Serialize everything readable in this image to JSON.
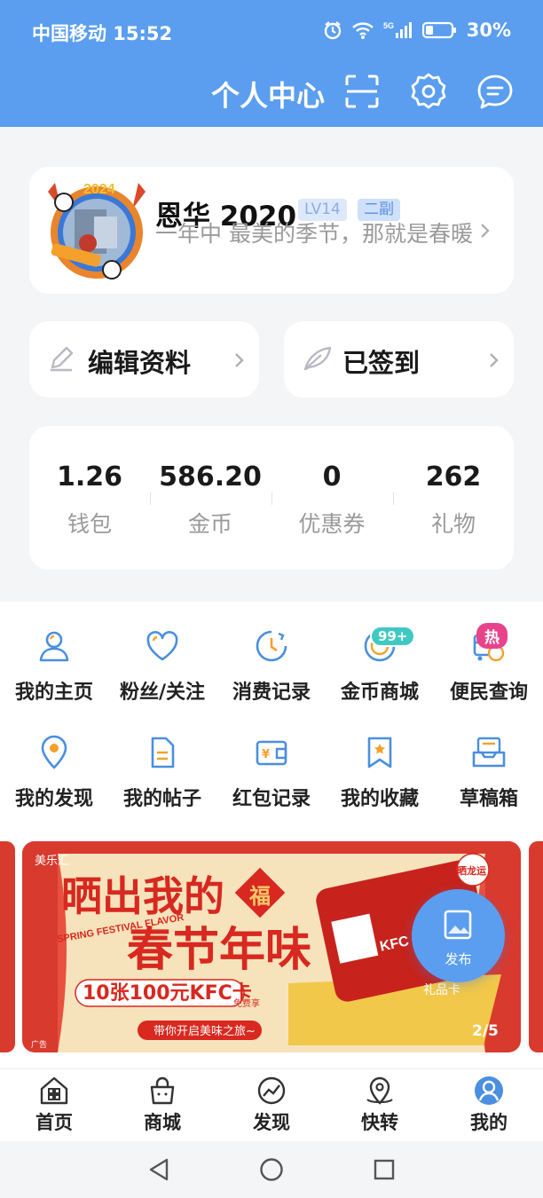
{
  "status_bar": {
    "carrier_time": "中国移动 15:52",
    "network": "5G",
    "battery": "30%"
  },
  "header": {
    "title": "个人中心",
    "scan_icon": "scan-icon",
    "settings_icon": "gear-icon",
    "message_icon": "chat-icon"
  },
  "profile": {
    "avatar_year": "2024",
    "username": "恩华 2020",
    "level": "LV14",
    "role": "二副",
    "signature": "一年中  最美的季节，那就是春暖"
  },
  "actions": {
    "edit": "编辑资料",
    "signin": "已签到"
  },
  "stats": [
    {
      "value": "1.26",
      "label": "钱包"
    },
    {
      "value": "586.20",
      "label": "金币"
    },
    {
      "value": "0",
      "label": "优惠券"
    },
    {
      "value": "262",
      "label": "礼物"
    }
  ],
  "grid": [
    {
      "label": "我的主页",
      "icon": "user-icon"
    },
    {
      "label": "粉丝/关注",
      "icon": "heart-icon"
    },
    {
      "label": "消费记录",
      "icon": "clock-icon"
    },
    {
      "label": "金币商城",
      "icon": "coin-icon",
      "badge": "99+"
    },
    {
      "label": "便民查询",
      "icon": "query-icon",
      "badge": "热"
    },
    {
      "label": "我的发现",
      "icon": "location-icon"
    },
    {
      "label": "我的帖子",
      "icon": "document-icon"
    },
    {
      "label": "红包记录",
      "icon": "wallet-icon"
    },
    {
      "label": "我的收藏",
      "icon": "bookmark-icon"
    },
    {
      "label": "草稿箱",
      "icon": "inbox-icon"
    }
  ],
  "banner": {
    "brand": "美乐汇",
    "headline1": "晒出我的",
    "headline2": "春节年味",
    "fu": "福",
    "english": "SPRING FESTIVAL FLAVOR",
    "prize": "10张100元KFC卡",
    "free": "免费享",
    "slogan": "带你开启美味之旅~",
    "card_brand": "KFC",
    "card_label": "礼品卡",
    "ad_tag": "广告",
    "corner": "晒龙运"
  },
  "fab": {
    "label": "发布"
  },
  "pager": "2/5",
  "tabbar": [
    {
      "label": "首页",
      "icon": "home-icon"
    },
    {
      "label": "商城",
      "icon": "shop-icon"
    },
    {
      "label": "发现",
      "icon": "discover-icon"
    },
    {
      "label": "快转",
      "icon": "transfer-icon"
    },
    {
      "label": "我的",
      "icon": "profile-icon",
      "active": true
    }
  ],
  "colors": {
    "primary": "#5b9ef0",
    "icon_blue": "#4a8fe0",
    "background": "#f4f5f7",
    "banner_red": "#d93a2e"
  }
}
